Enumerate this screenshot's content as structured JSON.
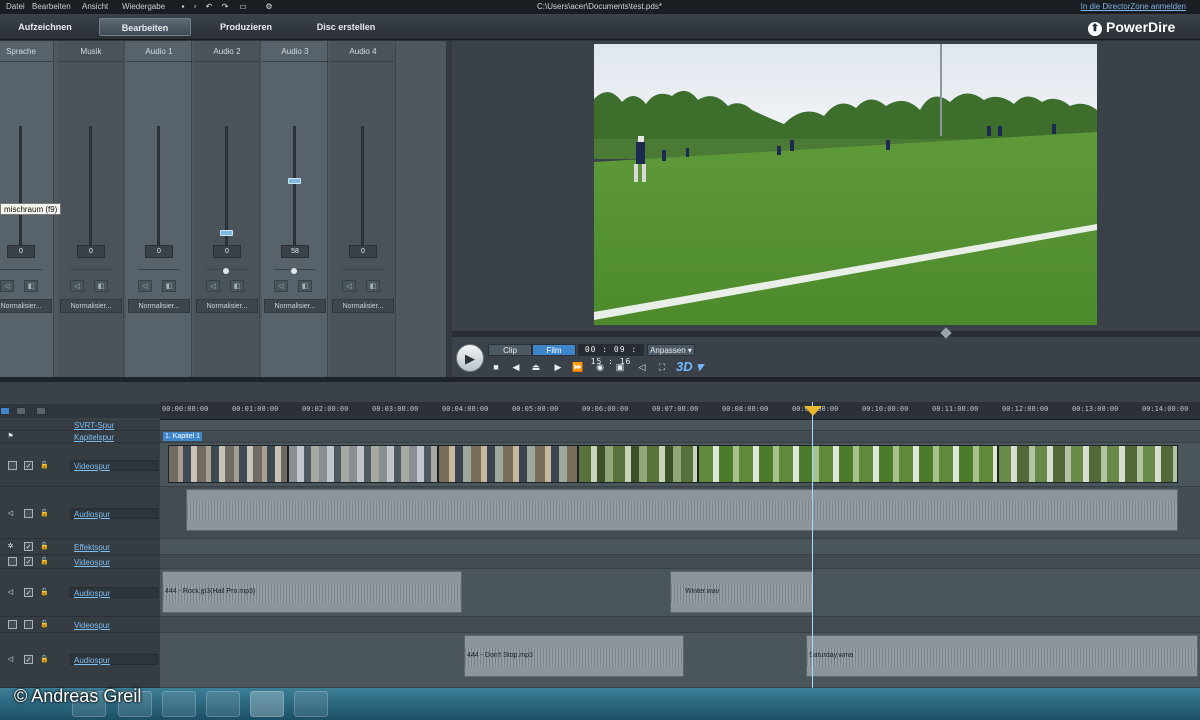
{
  "menu": {
    "items": [
      "Datei",
      "Bearbeiten",
      "Ansicht",
      "Wiedergabe"
    ],
    "file_path": "C:\\Users\\acer\\Documents\\test.pds*",
    "directorzone": "In die DirectorZone anmelden"
  },
  "modes": {
    "tabs": [
      "Aufzeichnen",
      "Bearbeiten",
      "Produzieren",
      "Disc erstellen"
    ],
    "active": "Bearbeiten",
    "brand": "PowerDire"
  },
  "mixer": {
    "channels": [
      {
        "label": "Sprache",
        "value": "0",
        "normalize": "Normalisier..."
      },
      {
        "label": "Musik",
        "value": "0",
        "normalize": "Normalisier..."
      },
      {
        "label": "Audio 1",
        "value": "0",
        "normalize": "Normalisier..."
      },
      {
        "label": "Audio 2",
        "value": "0",
        "normalize": "Normalisier..."
      },
      {
        "label": "Audio 3",
        "value": "58",
        "normalize": "Normalisier..."
      },
      {
        "label": "Audio 4",
        "value": "0",
        "normalize": "Normalisier..."
      }
    ],
    "tooltip": "mischraum (f9)"
  },
  "preview": {
    "mode_clip": "Clip",
    "mode_film": "Film",
    "timecode": "00 : 09 : 15 : 16",
    "fit": "Anpassen ▾",
    "three_d": "3D ▾"
  },
  "timeline": {
    "ruler": [
      "00:00:00:00",
      "00:01:00:00",
      "00:02:00:00",
      "00:03:00:00",
      "00:04:00:00",
      "00:05:00:00",
      "00:06:00:00",
      "00:07:00:00",
      "00:08:00:00",
      "00:09:00:00",
      "00:10:00:00",
      "00:11:00:00",
      "00:12:00:00",
      "00:13:00:00",
      "00:14:00:00"
    ],
    "tracks": {
      "svrt": "SVRT-Spur",
      "chapter": "Kapitelspur",
      "video1": "Videospur",
      "audio1": "Audiospur",
      "effect": "Effektspur",
      "video2": "Videospur",
      "audio2": "Audiospur",
      "video3": "Videospur",
      "audio3": "Audiospur"
    },
    "chapter_tag": "1. Kapitel 1",
    "clips": {
      "audio2a": "444 - Rock.jp3(Hall Pro.mp3)",
      "audio2b": "Winter.wav",
      "audio3a": "444 - Don't Stop.mp3",
      "audio3b": "Saturday.wma"
    }
  },
  "overlay": {
    "copyright": "© Andreas Greil"
  }
}
